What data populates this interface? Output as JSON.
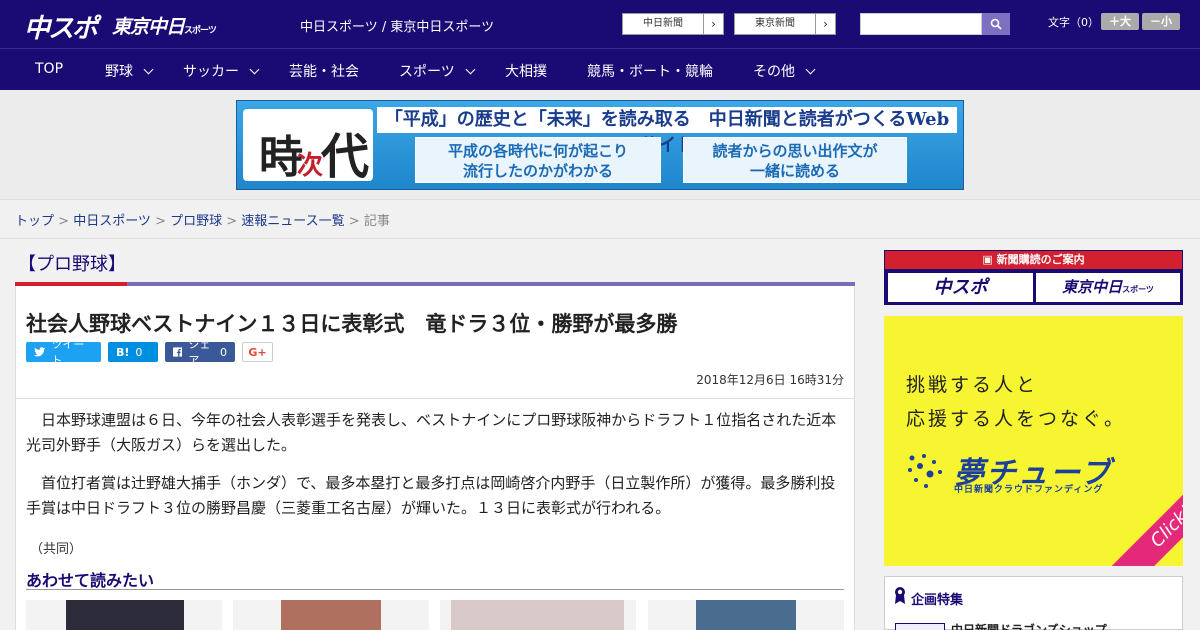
{
  "header": {
    "logo_main": "中スポ",
    "logo_tokyo": "東京中日",
    "logo_tokyo_suffix": "スポーツ",
    "site_name": "中日スポーツ / 東京中日スポーツ",
    "ext_links": [
      "中日新聞",
      "東京新聞"
    ],
    "search_placeholder": "",
    "fontsize_label": "文字（0）",
    "fontsize_plus": "＋大",
    "fontsize_minus": "－小"
  },
  "nav": {
    "items": [
      {
        "label": "TOP",
        "has_menu": false
      },
      {
        "label": "野球",
        "has_menu": true
      },
      {
        "label": "サッカー",
        "has_menu": true
      },
      {
        "label": "芸能・社会",
        "has_menu": false
      },
      {
        "label": "スポーツ",
        "has_menu": true
      },
      {
        "label": "大相撲",
        "has_menu": false
      },
      {
        "label": "競馬・ボート・競輪",
        "has_menu": false
      },
      {
        "label": "その他",
        "has_menu": true
      }
    ]
  },
  "banner": {
    "logo_char_1": "時",
    "logo_char_2": "次",
    "logo_char_3": "代",
    "headline": "「平成」の歴史と「未来」を読み取る　中日新聞と読者がつくるWebサイト",
    "box_left_1": "平成の各時代に何が起こり",
    "box_left_2": "流行したのかがわかる",
    "box_right_1": "読者からの思い出作文が",
    "box_right_2": "一緒に読める"
  },
  "breadcrumb": {
    "items": [
      "トップ",
      "中日スポーツ",
      "プロ野球",
      "速報ニュース一覧"
    ],
    "current": "記事"
  },
  "article": {
    "category": "【プロ野球】",
    "title": "社会人野球ベストナイン１３日に表彰式　竜ドラ３位・勝野が最多勝",
    "share": {
      "tweet": "ツイート",
      "hatena_icon": "B!",
      "hatena_count": "0",
      "facebook": "シェア",
      "facebook_count": "0",
      "gplus": "G+"
    },
    "date": "2018年12月6日 16時31分",
    "paragraphs": [
      "日本野球連盟は６日、今年の社会人表彰選手を発表し、ベストナインにプロ野球阪神からドラフト１位指名された近本光司外野手（大阪ガス）らを選出した。",
      "首位打者賞は辻野雄大捕手（ホンダ）で、最多本塁打と最多打点は岡崎啓介内野手（日立製作所）が獲得。最多勝利投手賞は中日ドラフト３位の勝野昌慶（三菱重工名古屋）が輝いた。１３日に表彰式が行われる。"
    ],
    "credit": "（共同）",
    "related_heading": "あわせて読みたい"
  },
  "sidebar": {
    "subscribe_heading": "新聞購読のご案内",
    "subscribe_buttons": [
      "中スポ",
      "東京中日"
    ],
    "subscribe_button_suffix": "スポーツ",
    "ad_line_1": "挑戦する人と",
    "ad_line_2": "応援する人をつなぐ。",
    "ad_logo": "夢チューブ",
    "ad_sub": "中日新聞クラウドファンディング",
    "ad_click": "Click!",
    "kikaku_heading": "企画特集",
    "kikaku_item": "中日新聞ドラゴンズショップ"
  },
  "colors": {
    "header_bg": "#1a0a73",
    "accent_red": "#d3202f",
    "link": "#1d3a8a",
    "yume_bg": "#f7f532"
  }
}
